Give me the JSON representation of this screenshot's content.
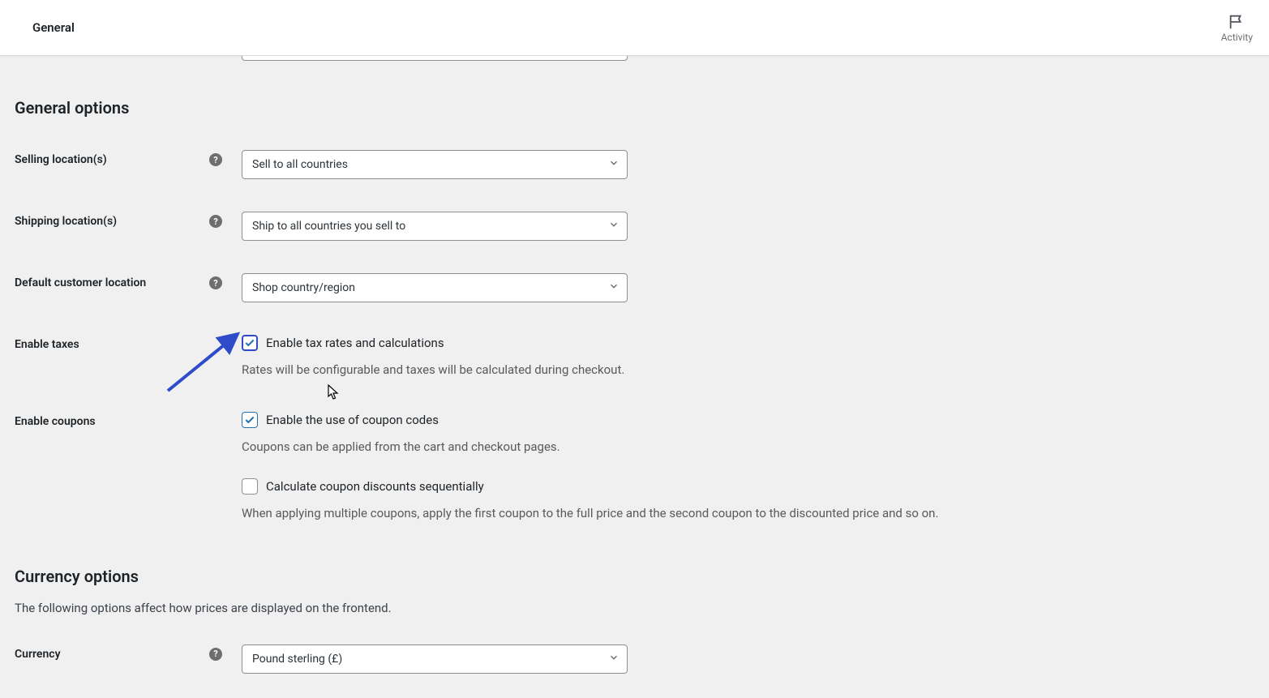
{
  "header": {
    "title": "General",
    "activity_label": "Activity"
  },
  "sections": {
    "general_options_title": "General options",
    "currency_options_title": "Currency options",
    "currency_options_desc": "The following options affect how prices are displayed on the frontend."
  },
  "fields": {
    "selling_locations": {
      "label": "Selling location(s)",
      "value": "Sell to all countries"
    },
    "shipping_locations": {
      "label": "Shipping location(s)",
      "value": "Ship to all countries you sell to"
    },
    "default_customer_location": {
      "label": "Default customer location",
      "value": "Shop country/region"
    },
    "enable_taxes": {
      "label": "Enable taxes",
      "checkbox_label": "Enable tax rates and calculations",
      "checked": true,
      "description": "Rates will be configurable and taxes will be calculated during checkout."
    },
    "enable_coupons": {
      "label": "Enable coupons",
      "checkbox1_label": "Enable the use of coupon codes",
      "checkbox1_checked": true,
      "desc1": "Coupons can be applied from the cart and checkout pages.",
      "checkbox2_label": "Calculate coupon discounts sequentially",
      "checkbox2_checked": false,
      "desc2": "When applying multiple coupons, apply the first coupon to the full price and the second coupon to the discounted price and so on."
    },
    "currency": {
      "label": "Currency",
      "value": "Pound sterling (£)"
    }
  }
}
